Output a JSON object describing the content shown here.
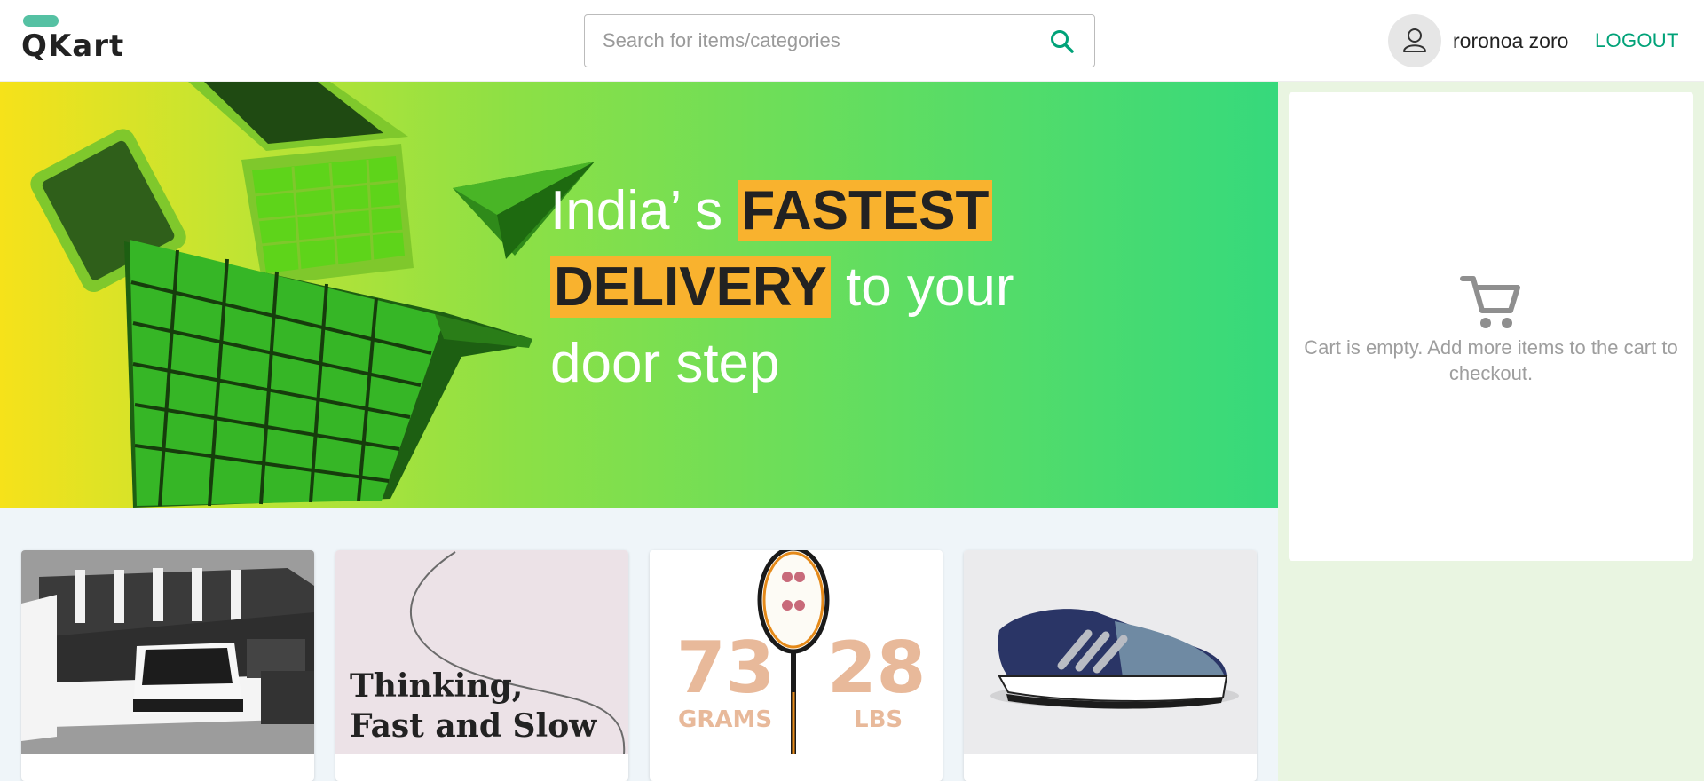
{
  "header": {
    "logo_text": "QKart",
    "search": {
      "placeholder": "Search for items/categories",
      "value": ""
    },
    "user": {
      "name": "roronoa zoro",
      "avatar_icon": "user-icon"
    },
    "logout_label": "LOGOUT"
  },
  "hero": {
    "line_a": "India’ s ",
    "highlight_1": "FASTEST",
    "highlight_2": "DELIVERY",
    "line_b": " to your",
    "line_c": "door step"
  },
  "cart": {
    "icon": "cart-icon",
    "empty_message": "Cart is empty. Add more items to the cart to checkout."
  },
  "products": [
    {
      "image_icon": "sofa-image"
    },
    {
      "image_text_1": "Thinking,",
      "image_text_2": "Fast and Slow"
    },
    {
      "stat_1_value": "73",
      "stat_1_unit": "GRAMS",
      "stat_2_value": "28",
      "stat_2_unit": "LBS"
    },
    {
      "image_icon": "shoe-image"
    }
  ],
  "colors": {
    "accent": "#00a278",
    "logo": "#55c1a3",
    "highlight": "#f9b22e",
    "sidebar_bg": "#e9f5e1"
  }
}
